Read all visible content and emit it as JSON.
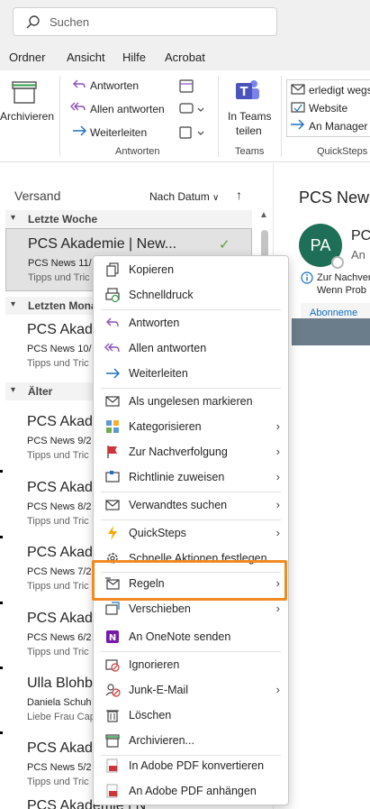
{
  "search": {
    "placeholder": "Suchen"
  },
  "menubar": {
    "items": [
      "Ordner",
      "Ansicht",
      "Hilfe",
      "Acrobat"
    ]
  },
  "ribbon": {
    "archive_label": "Archivieren",
    "reply": "Antworten",
    "reply_all": "Allen antworten",
    "forward": "Weiterleiten",
    "group_reply": "Antworten",
    "teams_line1": "In Teams",
    "teams_line2": "teilen",
    "group_teams": "Teams",
    "qs_1": "erledigt wegs",
    "qs_2": "Website",
    "qs_3": "An Manager",
    "group_quicksteps": "QuickSteps"
  },
  "list": {
    "header": "Versand",
    "sort_label": "Nach Datum",
    "groups": [
      "Letzte Woche",
      "Letzten Mona",
      "Älter"
    ],
    "messages": [
      {
        "from": "PCS Akademie | New...",
        "subject": "PCS News 11/",
        "preview": "Tipps und Tric"
      },
      {
        "from": "PCS Akade",
        "subject": "PCS News 10/",
        "preview": "Tipps und Tric"
      },
      {
        "from": "PCS Akade",
        "subject": "PCS News 9/2",
        "preview": "Tipps und Tric"
      },
      {
        "from": "PCS Akade",
        "subject": "PCS News 8/2",
        "preview": "Tipps und Tric"
      },
      {
        "from": "PCS Akade",
        "subject": "PCS News 7/2",
        "preview": "Tipps und Tric"
      },
      {
        "from": "PCS Akade",
        "subject": "PCS News 6/2",
        "preview": "Tipps und Tric"
      },
      {
        "from": "Ulla Blohbo",
        "subject": "Daniela Schuh",
        "preview": "Liebe Frau Cap"
      },
      {
        "from": "PCS Akade",
        "subject": "PCS News 5/2",
        "preview": "Tipps und Tric"
      },
      {
        "from": "PCS Akademie | N",
        "subject": "",
        "preview": ""
      }
    ]
  },
  "reading": {
    "title": "PCS News",
    "avatar_initials": "PA",
    "sender": "PCS",
    "to": "An",
    "info_line1": "Zur Nachver",
    "info_line2": "Wenn Prob",
    "subscription": "Abonneme"
  },
  "context_menu": {
    "items": [
      {
        "label": "Kopieren",
        "icon": "copy-icon"
      },
      {
        "label": "Schnelldruck",
        "icon": "quick-print-icon"
      },
      {
        "label": "Antworten",
        "icon": "reply-icon"
      },
      {
        "label": "Allen antworten",
        "icon": "reply-all-icon"
      },
      {
        "label": "Weiterleiten",
        "icon": "forward-icon"
      },
      {
        "label": "Als ungelesen markieren",
        "icon": "envelope-icon"
      },
      {
        "label": "Kategorisieren",
        "icon": "categorize-icon"
      },
      {
        "label": "Zur Nachverfolgung",
        "icon": "flag-icon"
      },
      {
        "label": "Richtlinie zuweisen",
        "icon": "policy-icon"
      },
      {
        "label": "Verwandtes suchen",
        "icon": "find-related-icon"
      },
      {
        "label": "QuickSteps",
        "icon": "lightning-icon"
      },
      {
        "label": "Schnelle Aktionen festlegen",
        "icon": "gear-icon"
      },
      {
        "label": "Regeln",
        "icon": "rules-icon"
      },
      {
        "label": "Verschieben",
        "icon": "move-icon"
      },
      {
        "label": "An OneNote senden",
        "icon": "onenote-icon"
      },
      {
        "label": "Ignorieren",
        "icon": "ignore-icon"
      },
      {
        "label": "Junk-E-Mail",
        "icon": "junk-icon"
      },
      {
        "label": "Löschen",
        "icon": "trash-icon"
      },
      {
        "label": "Archivieren...",
        "icon": "archive-icon"
      },
      {
        "label": "In Adobe PDF konvertieren",
        "icon": "pdf-convert-icon"
      },
      {
        "label": "An Adobe PDF anhängen",
        "icon": "pdf-attach-icon"
      }
    ]
  },
  "colors": {
    "highlight": "#f28a22",
    "accent": "#0f6cbd",
    "avatar": "#1f6e57"
  }
}
